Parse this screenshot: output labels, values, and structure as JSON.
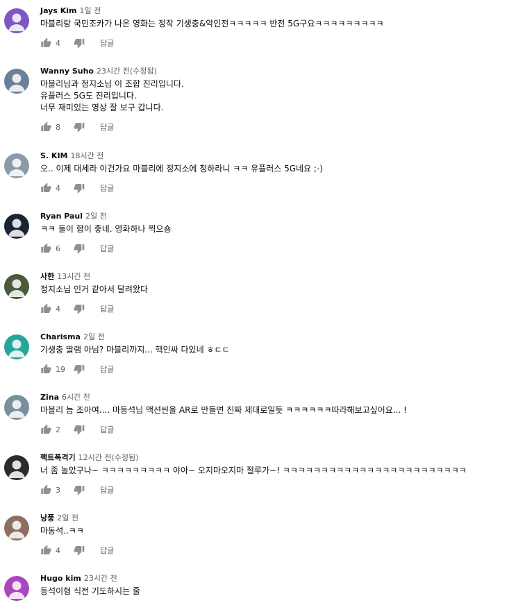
{
  "comments": [
    {
      "author": "Jays Kim",
      "time": "1일 전",
      "lines": [
        "마블리랑 국민조카가 나온 영화는 정작 기생충&악인전ㅋㅋㅋㅋㅋ 반전 5G구요ㅋㅋㅋㅋㅋㅋㅋㅋㅋ"
      ],
      "likes": "4",
      "reply": "답글",
      "avatar_color": "#7e57c2"
    },
    {
      "author": "Wanny Suho",
      "time": "23시간 전(수정됨)",
      "lines": [
        "마블리님과 정지소님 이 조합 진리입니다.",
        "유플러스 5G도 진리입니다.",
        "너무 재미있는 영상 잘 보구 갑니다."
      ],
      "likes": "8",
      "reply": "답글",
      "avatar_color": "#6b7f99"
    },
    {
      "author": "S. KIM",
      "time": "18시간 전",
      "lines": [
        "오.. 이제 대세라 이건가요 마블리에 정지소에 청하라니 ㅋㅋ 유플러스 5G네요 ;-)"
      ],
      "likes": "4",
      "reply": "답글",
      "avatar_color": "#8c9aa8"
    },
    {
      "author": "Ryan Paul",
      "time": "2일 전",
      "lines": [
        "ㅋㅋ 둘이 합이 좋네. 영화하나 찍으숑"
      ],
      "likes": "6",
      "reply": "답글",
      "avatar_color": "#1a2433"
    },
    {
      "author": "사한",
      "time": "13시간 전",
      "lines": [
        "정지소님 인거 같아서 달려왔다"
      ],
      "likes": "4",
      "reply": "답글",
      "avatar_color": "#4a5a3a"
    },
    {
      "author": "Charisma",
      "time": "2일 전",
      "lines": [
        "기생충 딸램 아님? 마블리까지... 핵인싸 다있네 ㅎㄷㄷ"
      ],
      "likes": "19",
      "reply": "답글",
      "avatar_color": "#26a69a"
    },
    {
      "author": "Zina",
      "time": "6시간 전",
      "lines": [
        "마블리 늠 조아여.... 마동석님 액션씬을 AR로 만들면 진짜 제대로일듯 ㅋㅋㅋㅋㅋㅋ따라해보고싶어요... !"
      ],
      "likes": "2",
      "reply": "답글",
      "avatar_color": "#78909c"
    },
    {
      "author": "팩트폭격기",
      "time": "12시간 전(수정됨)",
      "lines": [
        "너 좀 놀았구나~  ㅋㅋㅋㅋㅋㅋㅋㅋㅋ 야아~ 오지마오지마 절루가~! ㅋㅋㅋㅋㅋㅋㅋㅋㅋㅋㅋㅋㅋㅋㅋㅋㅋㅋㅋㅋㅋㅋㅋㅋ"
      ],
      "likes": "3",
      "reply": "답글",
      "avatar_color": "#2b2b2b"
    },
    {
      "author": "낭풍",
      "time": "2일 전",
      "lines": [
        "마동석..ㅋㅋ"
      ],
      "likes": "4",
      "reply": "답글",
      "avatar_color": "#8d6e63"
    },
    {
      "author": "Hugo kim",
      "time": "23시간 전",
      "lines": [
        "동석이형 식전 기도하시는 줄"
      ],
      "likes": "",
      "reply": "",
      "avatar_color": "#ab47bc"
    }
  ]
}
